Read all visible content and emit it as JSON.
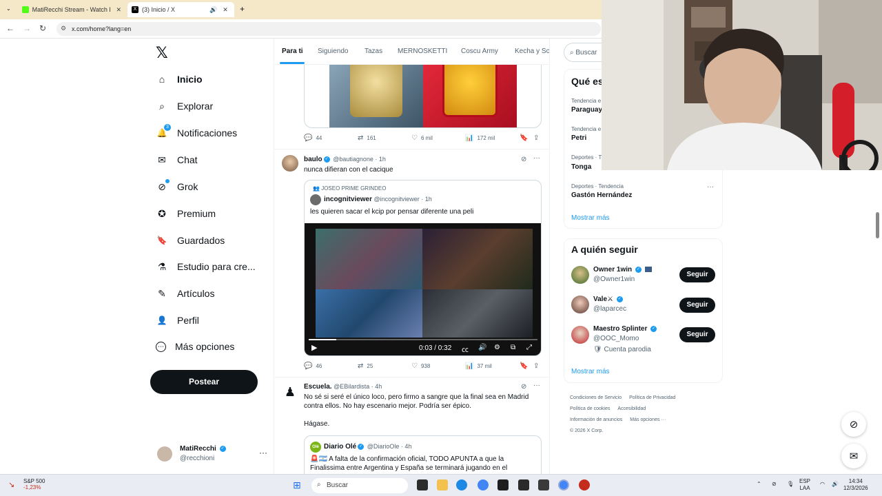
{
  "browser": {
    "tabs": [
      {
        "title": "MatiRecchi Stream - Watch Live",
        "close": "✕"
      },
      {
        "title": "(3) Inicio / X",
        "close": "✕"
      }
    ],
    "new_tab": "+",
    "url": "x.com/home?lang=en",
    "back": "←",
    "forward": "→",
    "reload": "↻"
  },
  "sidebar": {
    "logo": "𝕏",
    "notifications_badge": "3",
    "items": [
      {
        "label": "Inicio",
        "icon": "home-icon",
        "glyph": "⌂"
      },
      {
        "label": "Explorar",
        "icon": "search-icon",
        "glyph": "⌕"
      },
      {
        "label": "Notificaciones",
        "icon": "bell-icon",
        "glyph": "🔔"
      },
      {
        "label": "Chat",
        "icon": "mail-icon",
        "glyph": "✉"
      },
      {
        "label": "Grok",
        "icon": "grok-icon",
        "glyph": "⊘"
      },
      {
        "label": "Premium",
        "icon": "verified-icon",
        "glyph": "✪"
      },
      {
        "label": "Guardados",
        "icon": "bookmark-icon",
        "glyph": "🔖"
      },
      {
        "label": "Estudio para cre...",
        "icon": "flask-icon",
        "glyph": "⚗"
      },
      {
        "label": "Artículos",
        "icon": "article-icon",
        "glyph": "✎"
      },
      {
        "label": "Perfil",
        "icon": "person-icon",
        "glyph": "👤"
      },
      {
        "label": "Más opciones",
        "icon": "more-circle-icon",
        "glyph": "⋯"
      }
    ],
    "post_button": "Postear",
    "account": {
      "name": "MatiRecchi",
      "handle": "@recchioni",
      "more": "···"
    }
  },
  "feed": {
    "tabs": [
      "Para ti",
      "Siguiendo",
      "Tazas",
      "MERNOSKETTI",
      "Coscu Army",
      "Kecha y Sc"
    ],
    "post0_actions": {
      "replies": "44",
      "reposts": "161",
      "likes": "6 mil",
      "views": "172 mil"
    },
    "post1": {
      "name": "baulo",
      "handle": "@bautiagnone",
      "time": "· 1h",
      "text": "nunca difieran con el cacique",
      "quote": {
        "context": "JOSEO PRIME GRINDEO",
        "name": "incognitviewer",
        "handle": "@incognitviewer",
        "time": "· 1h",
        "text": "les quieren sacar el kcip por pensar diferente una peli"
      },
      "video_time": "0:03 / 0:32",
      "actions": {
        "replies": "46",
        "reposts": "25",
        "likes": "938",
        "views": "37 mil"
      }
    },
    "post2": {
      "name": "Escuela.",
      "handle": "@EBilardista",
      "time": "· 4h",
      "text_line1": "No sé si seré el único loco, pero firmo a sangre que la final sea en Madrid",
      "text_line2": "contra ellos. No hay escenario mejor. Podría ser épico.",
      "text_line3": "Hágase.",
      "quote": {
        "name": "Diario Olé",
        "handle": "@DiarioOle",
        "time": "· 4h",
        "text_line1": "🚨🇦🇷 A falta de la confirmación oficial, TODO APUNTA a que la",
        "text_line2": "Finalissima entre Argentina y España se terminará jugando en el"
      }
    }
  },
  "right": {
    "search_placeholder": "Buscar",
    "trends_title": "Qué es",
    "trends": [
      {
        "category": "Tendencia e",
        "name": "Paraguay"
      },
      {
        "category": "Tendencia e",
        "name": "Petri"
      },
      {
        "category": "Deportes · T",
        "name": "Tonga"
      },
      {
        "category": "Deportes · Tendencia",
        "name": "Gastón Hernández"
      }
    ],
    "show_more": "Mostrar más",
    "follow_title": "A quién seguir",
    "follow": [
      {
        "name": "Owner 1win",
        "handle": "@Owner1win",
        "button": "Seguir"
      },
      {
        "name": "Vale",
        "handle": "@laparcec",
        "button": "Seguir"
      },
      {
        "name": "Maestro Splinter",
        "handle": "@OOC_Momo",
        "button": "Seguir",
        "note": "Cuenta parodia"
      }
    ],
    "follow_show_more": "Mostrar más",
    "footer": [
      "Condiciones de Servicio",
      "Política de Privacidad",
      "Política de cookies",
      "Accesibilidad",
      "Información de anuncios",
      "Más opciones ···",
      "© 2026 X Corp."
    ]
  },
  "taskbar": {
    "stock_name": "S&P 500",
    "stock_change": "-1,23%",
    "search": "Buscar",
    "lang_top": "ESP",
    "lang_bottom": "LAA",
    "time": "14:34",
    "date": "12/3/2026"
  },
  "colors": {
    "accent": "#1d9bf0",
    "text": "#0f1419",
    "muted": "#536471"
  }
}
